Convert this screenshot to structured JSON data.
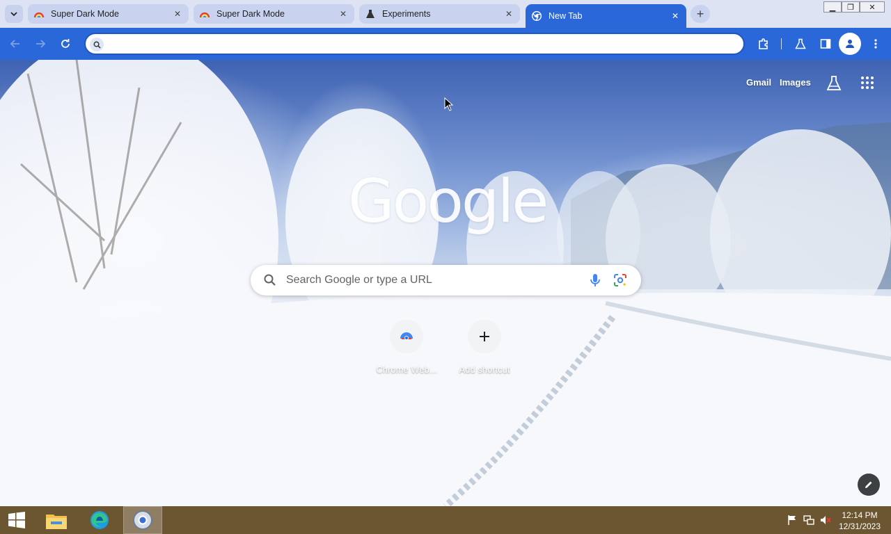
{
  "browser": {
    "tabs": [
      {
        "title": "Super Dark Mode",
        "icon": "rainbow-extension-icon",
        "active": false
      },
      {
        "title": "Super Dark Mode",
        "icon": "rainbow-extension-icon",
        "active": false
      },
      {
        "title": "Experiments",
        "icon": "flask-icon",
        "active": false
      },
      {
        "title": "New Tab",
        "icon": "chrome-icon",
        "active": true
      }
    ],
    "omnibox": {
      "value": "",
      "placeholder": ""
    },
    "accent_color": "#2a68d9"
  },
  "ntp": {
    "links": {
      "gmail": "Gmail",
      "images": "Images"
    },
    "logo_text": "Google",
    "search_placeholder": "Search Google or type a URL",
    "shortcuts": [
      {
        "label": "Chrome Web...",
        "icon": "chrome-web-store-icon"
      },
      {
        "label": "Add shortcut",
        "icon": "plus-icon"
      }
    ]
  },
  "taskbar": {
    "apps": [
      "start-icon",
      "file-explorer-icon",
      "edge-icon",
      "chrome-icon"
    ],
    "clock": {
      "time": "12:14 PM",
      "date": "12/31/2023"
    }
  }
}
